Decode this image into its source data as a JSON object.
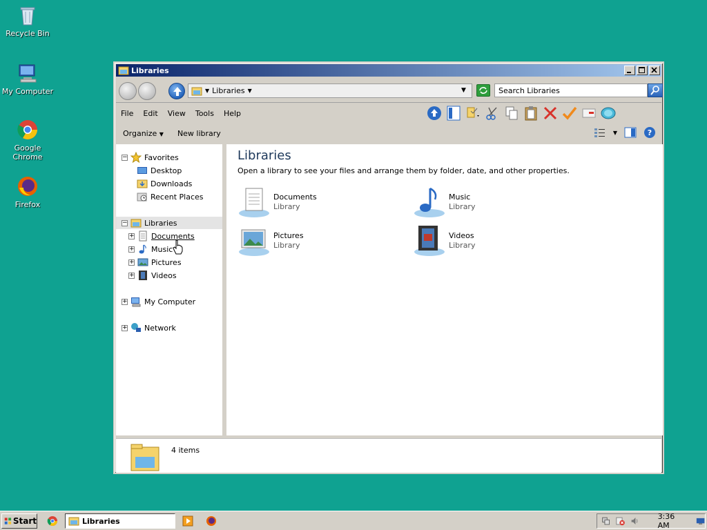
{
  "desktop": {
    "icons": [
      {
        "label": "Recycle Bin",
        "icon": "recycle-bin-icon"
      },
      {
        "label": "My Computer",
        "icon": "computer-icon"
      },
      {
        "label": "Google Chrome",
        "icon": "chrome-icon"
      },
      {
        "label": "Firefox",
        "icon": "firefox-icon"
      }
    ]
  },
  "window": {
    "title": "Libraries",
    "address": {
      "crumb": "Libraries"
    },
    "search_placeholder": "Search Libraries",
    "menu": [
      "File",
      "Edit",
      "View",
      "Tools",
      "Help"
    ],
    "commands": {
      "organize": "Organize",
      "new_library": "New library"
    },
    "nav": {
      "favorites": "Favorites",
      "favorites_items": [
        "Desktop",
        "Downloads",
        "Recent Places"
      ],
      "libraries": "Libraries",
      "libraries_items": [
        "Documents",
        "Music",
        "Pictures",
        "Videos"
      ],
      "my_computer": "My Computer",
      "network": "Network"
    },
    "content": {
      "heading": "Libraries",
      "description": "Open a library to see your files and arrange them by folder, date, and other properties.",
      "items": [
        {
          "name": "Documents",
          "type": "Library"
        },
        {
          "name": "Music",
          "type": "Library"
        },
        {
          "name": "Pictures",
          "type": "Library"
        },
        {
          "name": "Videos",
          "type": "Library"
        }
      ]
    },
    "status": {
      "count": "4 items"
    }
  },
  "taskbar": {
    "start": "Start",
    "task": "Libraries",
    "clock": "3:36 AM"
  },
  "colors": {
    "desktop": "#0fa291",
    "title_gradient_start": "#0a246a",
    "title_gradient_end": "#a6caf0"
  }
}
